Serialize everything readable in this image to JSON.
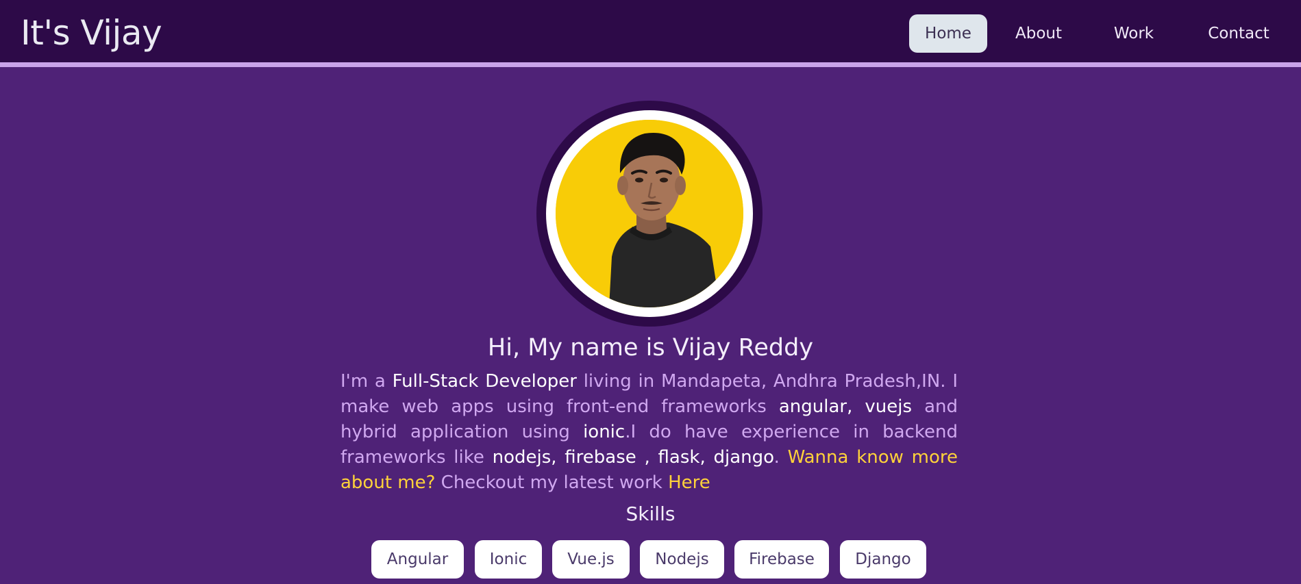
{
  "navbar": {
    "brand": "It's Vijay",
    "items": [
      {
        "label": "Home",
        "active": true
      },
      {
        "label": "About",
        "active": false
      },
      {
        "label": "Work",
        "active": false
      },
      {
        "label": "Contact",
        "active": false
      }
    ]
  },
  "profile": {
    "greeting": "Hi, My name is Vijay Reddy",
    "bio": {
      "t1": "I'm a ",
      "role": "Full-Stack Developer",
      "t2": " living in Mandapeta, Andhra Pradesh,IN. I make web apps using front-end frameworks ",
      "frontend": "angular, vuejs",
      "t3": " and hybrid application using ",
      "hybrid": "ionic",
      "t4": ".I do have experience in backend frameworks like ",
      "backend": "nodejs, firebase , flask, django",
      "t5": ". ",
      "more_link": "Wanna know more about me?",
      "t6": " Checkout my latest work ",
      "here_link": "Here"
    }
  },
  "skills": {
    "title": "Skills",
    "items": [
      "Angular",
      "Ionic",
      "Vue.js",
      "Nodejs",
      "Firebase",
      "Django"
    ]
  },
  "colors": {
    "page_bg": "#4f2277",
    "navbar_bg": "#2d0a48",
    "navbar_border": "#c9a3ea",
    "photo_bg": "#f8cc07",
    "link": "#ffd23a",
    "bio_text": "#d0a8f0"
  }
}
